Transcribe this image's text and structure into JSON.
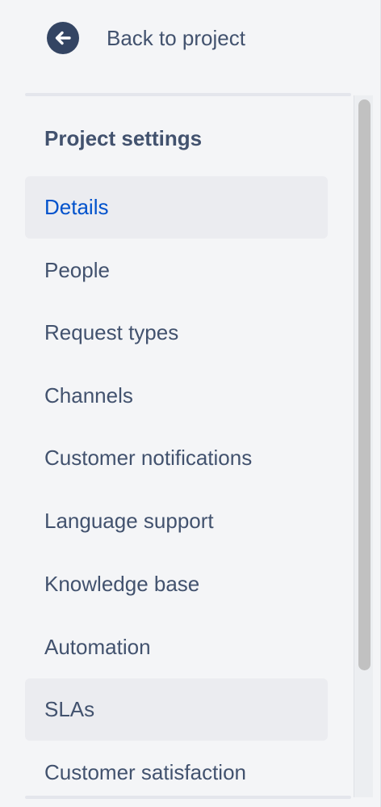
{
  "back": {
    "label": "Back to project",
    "icon": "arrow-left-circle-icon"
  },
  "section": {
    "title": "Project settings"
  },
  "nav": {
    "items": [
      {
        "label": "Details",
        "state": "selected"
      },
      {
        "label": "People",
        "state": "normal"
      },
      {
        "label": "Request types",
        "state": "normal"
      },
      {
        "label": "Channels",
        "state": "normal"
      },
      {
        "label": "Customer notifications",
        "state": "normal"
      },
      {
        "label": "Language support",
        "state": "normal"
      },
      {
        "label": "Knowledge base",
        "state": "normal"
      },
      {
        "label": "Automation",
        "state": "normal"
      },
      {
        "label": "SLAs",
        "state": "hovered"
      },
      {
        "label": "Customer satisfaction",
        "state": "normal"
      }
    ]
  },
  "colors": {
    "background": "#f4f5f7",
    "text": "#42526e",
    "selected_text": "#0052cc",
    "selected_background": "#ebecf0",
    "icon": "#344563"
  }
}
